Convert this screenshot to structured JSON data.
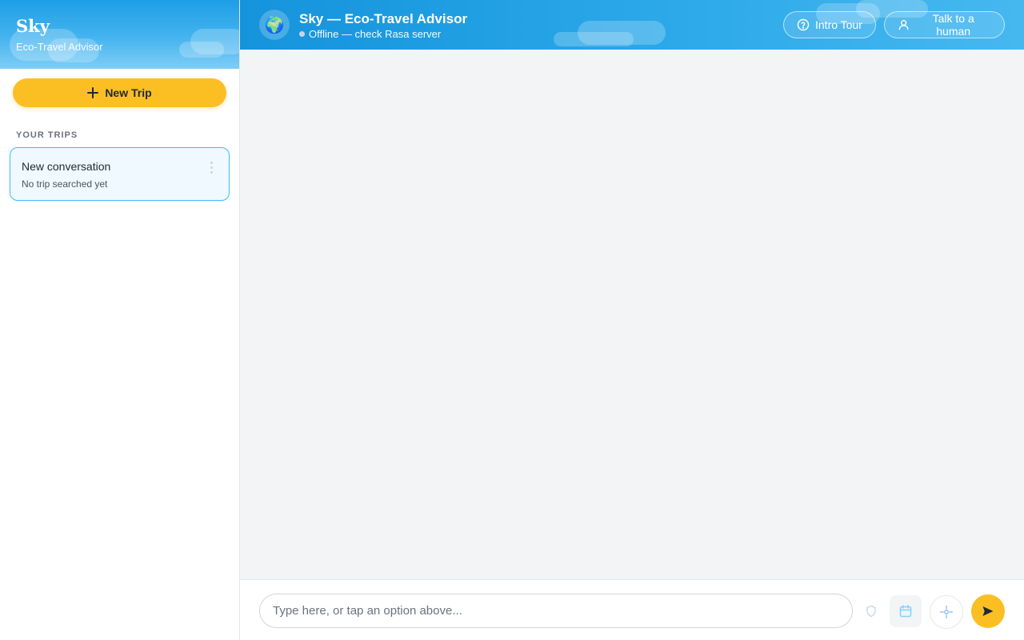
{
  "sidebar": {
    "brand_title": "Sky",
    "brand_subtitle": "Eco-Travel Advisor",
    "new_trip_label": "New Trip",
    "section_label": "YOUR TRIPS",
    "trips": [
      {
        "title": "New conversation",
        "subtitle": "No trip searched yet"
      }
    ]
  },
  "header": {
    "avatar_glyph": "🌍",
    "title": "Sky — Eco-Travel Advisor",
    "status": "Offline — check Rasa server",
    "intro_tour_label": "Intro Tour",
    "talk_human_label": "Talk to a human"
  },
  "composer": {
    "placeholder": "Type here, or tap an option above..."
  },
  "icons": {
    "new_trip": "plus-icon",
    "intro_tour": "help-circle-icon",
    "talk_human": "user-icon",
    "trip_menu": "more-vertical-icon",
    "shield": "shield-icon",
    "calendar": "calendar-icon",
    "location": "crosshair-icon",
    "send": "send-icon"
  },
  "colors": {
    "accent_yellow": "#fbbf24",
    "header_blue": "#29a7e8",
    "selected_border": "#38bdf8",
    "status_offline": "#cbd5e1"
  }
}
